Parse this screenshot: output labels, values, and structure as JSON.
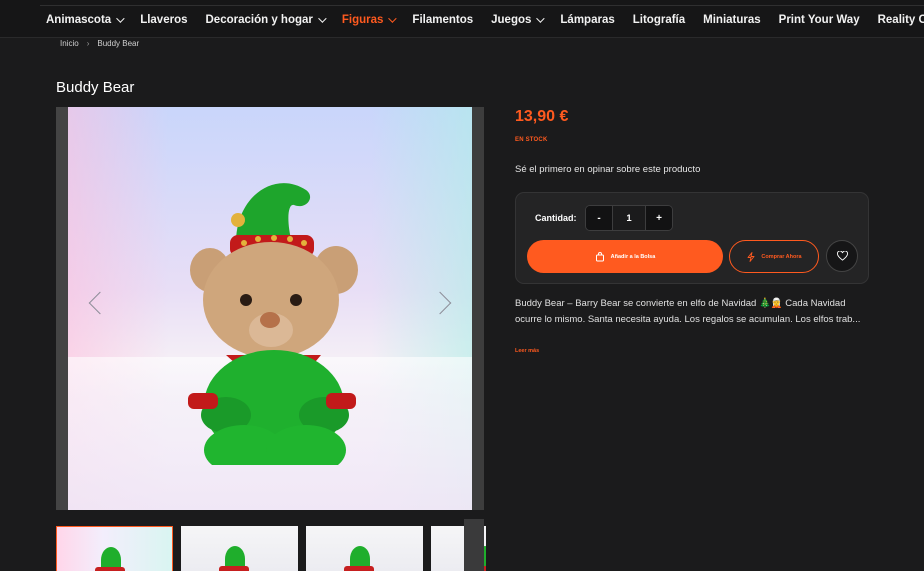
{
  "nav": {
    "items": [
      {
        "label": "Animascota",
        "has_dropdown": true,
        "active": false
      },
      {
        "label": "Llaveros",
        "has_dropdown": false,
        "active": false
      },
      {
        "label": "Decoración y hogar",
        "has_dropdown": true,
        "active": false
      },
      {
        "label": "Figuras",
        "has_dropdown": true,
        "active": true
      },
      {
        "label": "Filamentos",
        "has_dropdown": false,
        "active": false
      },
      {
        "label": "Juegos",
        "has_dropdown": true,
        "active": false
      },
      {
        "label": "Lámparas",
        "has_dropdown": false,
        "active": false
      },
      {
        "label": "Litografía",
        "has_dropdown": false,
        "active": false
      },
      {
        "label": "Miniaturas",
        "has_dropdown": false,
        "active": false
      },
      {
        "label": "Print Your Way",
        "has_dropdown": false,
        "active": false
      },
      {
        "label": "Reality Chromatics",
        "has_dropdown": false,
        "active": false
      }
    ]
  },
  "breadcrumb": {
    "home": "Inicio",
    "separator": "›",
    "current": "Buddy Bear"
  },
  "product": {
    "title": "Buddy Bear",
    "price": "13,90 €",
    "stock": "EN STOCK",
    "review_prompt": "Sé el primero en opinar sobre este producto",
    "quantity_label": "Cantidad:",
    "quantity_value": "1",
    "decrement": "-",
    "increment": "+",
    "add_to_cart": "Añadir a la Bolsa",
    "buy_now": "Comprar Ahora",
    "description": "Buddy Bear – Barry Bear se convierte en elfo de Navidad 🎄🧝 Cada Navidad ocurre lo mismo. Santa necesita ayuda. Los regalos se acumulan. Los elfos trab...",
    "read_more": "Leer más"
  },
  "gallery": {
    "thumbnail_count": 4
  },
  "colors": {
    "accent": "#ff5a1f",
    "background": "#1b1b1c",
    "panel": "#242425"
  },
  "icons": {
    "prev": "chevron-left-icon",
    "next": "chevron-right-icon",
    "bag": "bag-icon",
    "bolt": "bolt-icon",
    "wishlist": "heart-icon"
  }
}
